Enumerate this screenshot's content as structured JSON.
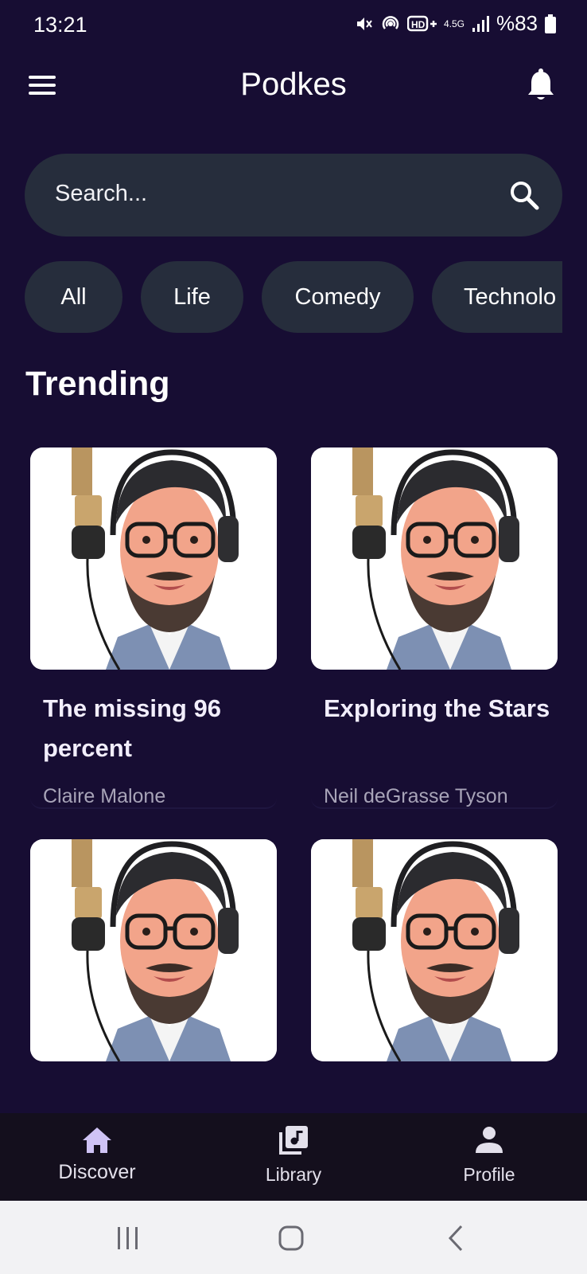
{
  "status_bar": {
    "time": "13:21",
    "network": "4.5G",
    "battery": "%83",
    "icons": [
      "mute-icon",
      "hotspot-icon",
      "hd-voice-icon",
      "signal-icon",
      "battery-icon"
    ]
  },
  "app_bar": {
    "title": "Podkes",
    "menu_icon": "hamburger-menu-icon",
    "notification_icon": "bell-icon"
  },
  "search": {
    "placeholder": "Search...",
    "icon": "search-icon"
  },
  "categories": [
    "All",
    "Life",
    "Comedy",
    "Technolo"
  ],
  "trending": {
    "title": "Trending",
    "items": [
      {
        "title": "The missing 96 percent",
        "author": "Claire Malone"
      },
      {
        "title": "Exploring the Stars",
        "author": "Neil deGrasse Tyson"
      },
      {
        "title": "",
        "author": ""
      },
      {
        "title": "",
        "author": ""
      }
    ]
  },
  "bottom_nav": {
    "items": [
      {
        "label": "Discover",
        "icon": "home-icon",
        "active": true
      },
      {
        "label": "Library",
        "icon": "library-music-icon",
        "active": false
      },
      {
        "label": "Profile",
        "icon": "person-icon",
        "active": false
      }
    ]
  },
  "system_nav": [
    "recents-icon",
    "home-circle-icon",
    "back-icon"
  ],
  "colors": {
    "background": "#170d33",
    "surface": "#262d3c",
    "nav_background": "#140f1d",
    "active_icon": "#cfc3f5",
    "muted_text": "#a8a4b8"
  }
}
